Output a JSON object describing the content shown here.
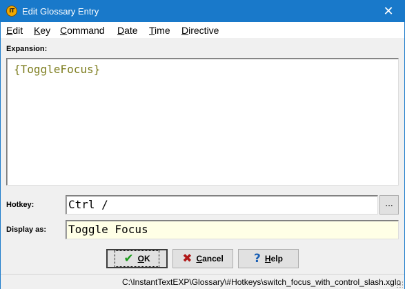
{
  "window": {
    "title": "Edit Glossary Entry",
    "app_icon_text": "IT",
    "close_glyph": "✕"
  },
  "menu": [
    {
      "prefix": "",
      "hotkey": "E",
      "rest": "dit"
    },
    {
      "prefix": "",
      "hotkey": "K",
      "rest": "ey"
    },
    {
      "prefix": "",
      "hotkey": "C",
      "rest": "ommand"
    },
    {
      "prefix": "",
      "hotkey": "D",
      "rest": "ate"
    },
    {
      "prefix": "",
      "hotkey": "T",
      "rest": "ime"
    },
    {
      "prefix": "",
      "hotkey": "D",
      "rest": "irective"
    }
  ],
  "expansion": {
    "label": "Expansion:",
    "text": "{ToggleFocus}",
    "text_color": "#7c7c1c"
  },
  "hotkey": {
    "label": "Hotkey:",
    "value": "Ctrl /",
    "browse_label": "..."
  },
  "display_as": {
    "label": "Display as:",
    "value": "Toggle Focus",
    "background": "#ffffe6"
  },
  "buttons": {
    "ok": {
      "hotkey": "O",
      "rest": "K",
      "icon": "checkmark-icon",
      "glyph": "✔",
      "color": "#1a9a1a"
    },
    "cancel": {
      "hotkey": "C",
      "rest": "ancel",
      "icon": "x-icon",
      "glyph": "✖",
      "color": "#b01818"
    },
    "help": {
      "hotkey": "H",
      "rest": "elp",
      "icon": "question-icon",
      "glyph": "?",
      "color": "#1a5fb4"
    }
  },
  "status": {
    "path": "C:\\InstantTextEXP\\Glossary\\#Hotkeys\\switch_focus_with_control_slash.xglo"
  },
  "colors": {
    "titlebar": "#1979ca"
  }
}
